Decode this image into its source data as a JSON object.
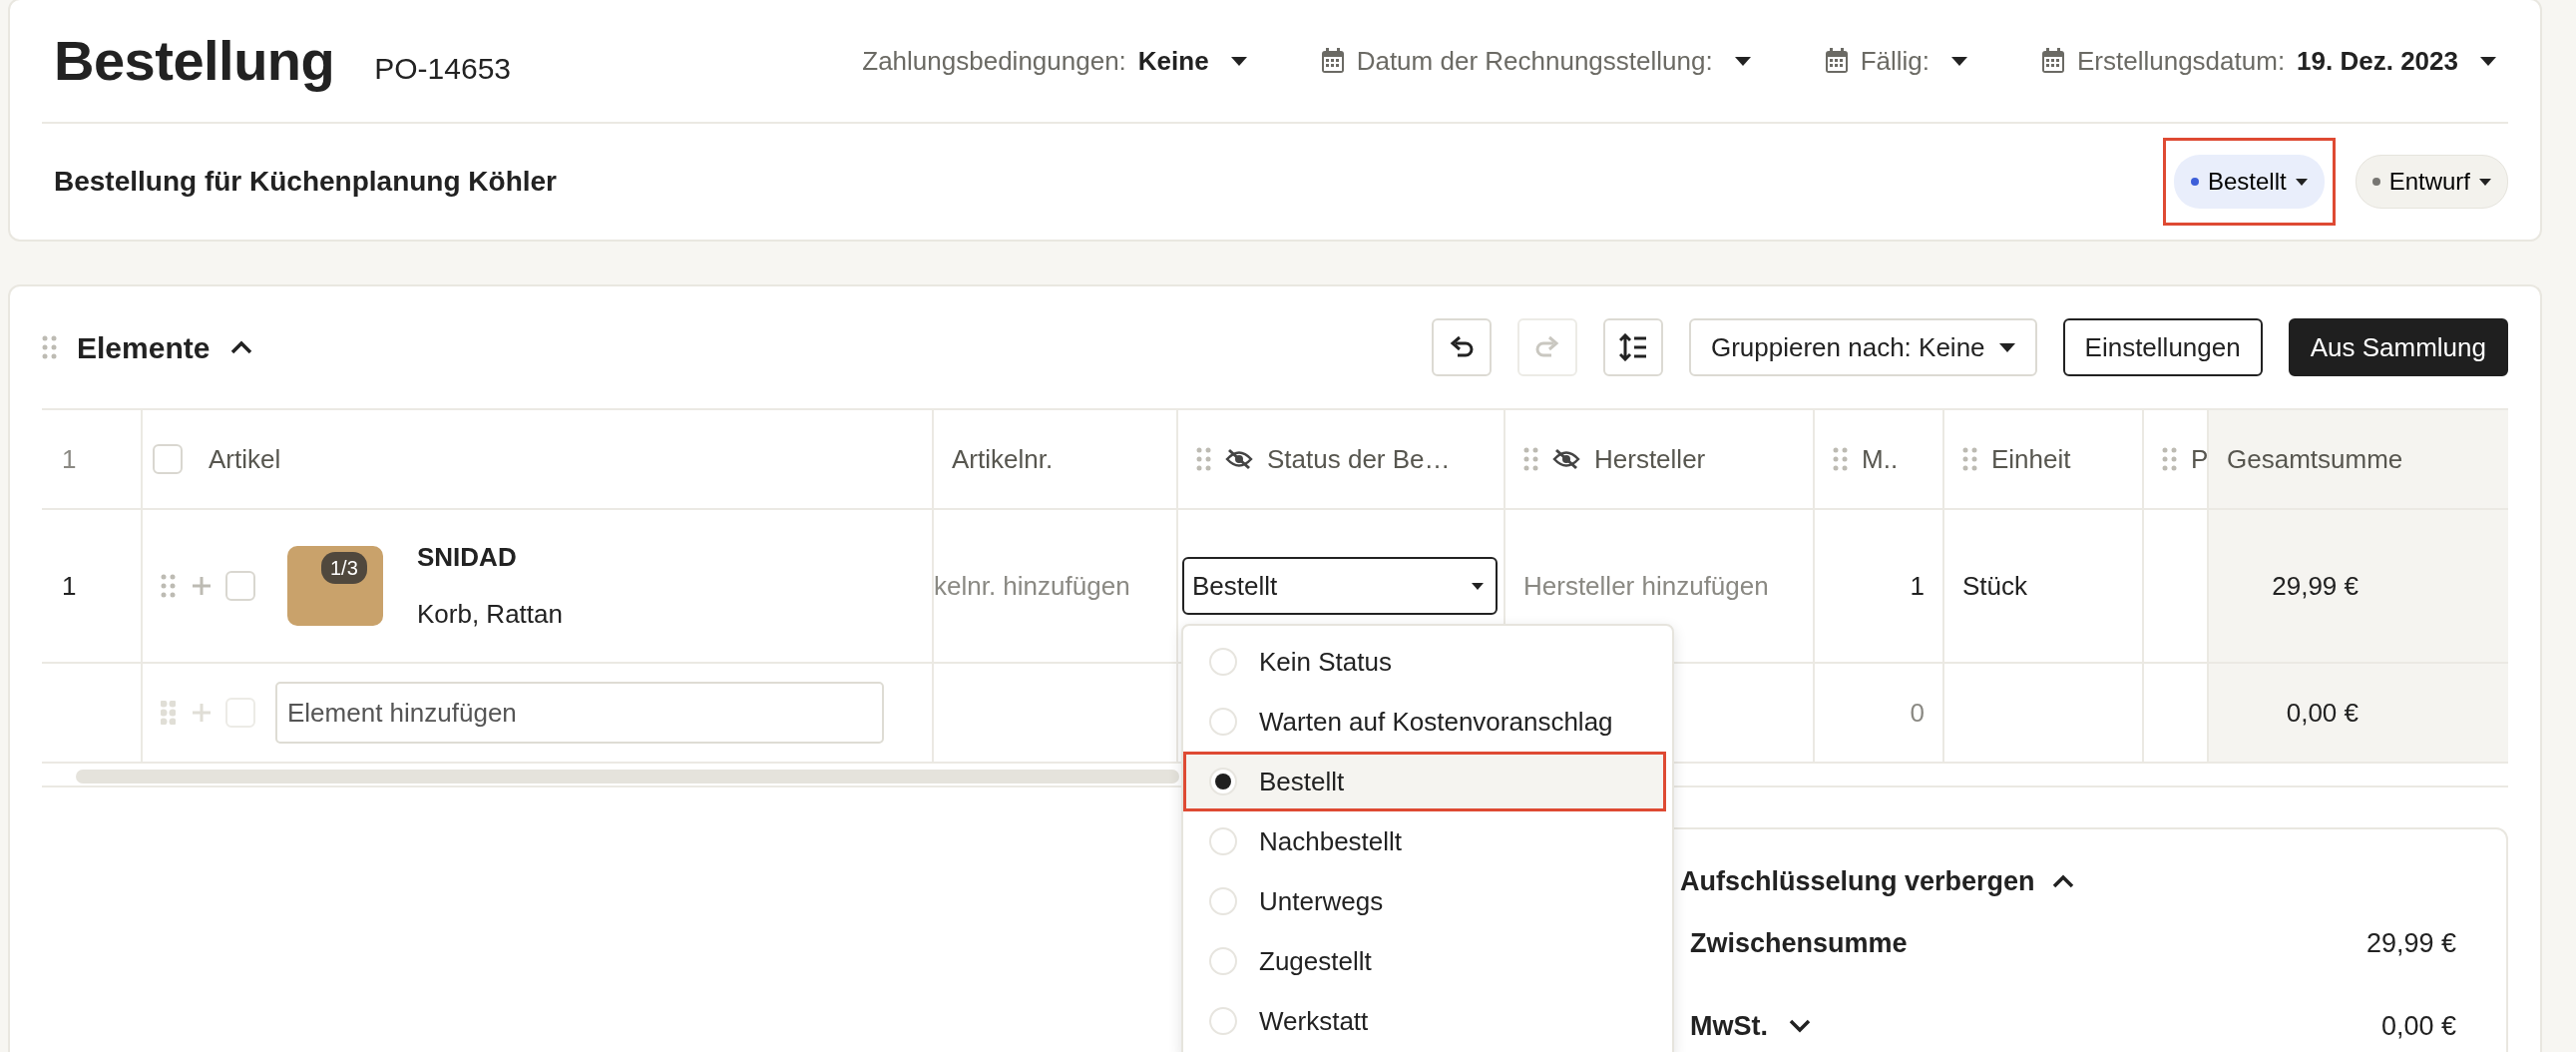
{
  "header": {
    "title": "Bestellung",
    "number": "PO-14653",
    "fields": [
      {
        "label": "Zahlungsbedingungen:",
        "value": "Keine",
        "icon": false
      },
      {
        "label": "Datum der Rechnungsstellung:",
        "icon": true
      },
      {
        "label": "Fällig:",
        "icon": true
      },
      {
        "label": "Erstellungsdatum:",
        "value": "19. Dez. 2023",
        "icon": true
      }
    ],
    "subtitle": "Bestellung für Küchenplanung Köhler",
    "pills": [
      {
        "label": "Bestellt",
        "color": "#3d5fd9",
        "highlighted": true
      },
      {
        "label": "Entwurf",
        "color": "#777672",
        "highlighted": false
      }
    ]
  },
  "items": {
    "title": "Elemente",
    "expanded": true,
    "toolbar": {
      "icon_buttons": [
        {
          "kind": "undo",
          "disabled": false
        },
        {
          "kind": "redo",
          "disabled": true
        },
        {
          "kind": "row-height",
          "disabled": false
        }
      ],
      "group_by": "Gruppieren nach: Keine",
      "buttons": [
        {
          "label": "Einstellungen",
          "kind": "outline"
        },
        {
          "label": "Aus Sammlung",
          "kind": "dark"
        }
      ]
    },
    "table": {
      "header_number": "1",
      "columns": [
        {
          "label": "Artikel",
          "kind": "item",
          "checked": false
        },
        {
          "label": "Artikelnr.",
          "kind": "plain"
        },
        {
          "label": "Status der Be…",
          "kind": "hidden"
        },
        {
          "label": "Hersteller",
          "kind": "hidden"
        },
        {
          "label": "M..",
          "kind": "drag"
        },
        {
          "label": "Einheit",
          "kind": "drag"
        },
        {
          "label": "P",
          "kind": "drag"
        },
        {
          "label": "Gesamtsumme",
          "kind": "total"
        }
      ],
      "rows": [
        {
          "number": "1",
          "checked": false,
          "name": "SNIDAD",
          "description": "Korb, Rattan",
          "image_count": "1/3",
          "article_no": {
            "placeholder": "kelnr. hinzufügen"
          },
          "status": "Bestellt",
          "manufacturer": {
            "placeholder": "Hersteller hinzufügen"
          },
          "quantity": "1",
          "unit": "Stück",
          "total": "29,99 €"
        }
      ],
      "new_row": {
        "checked": false,
        "placeholder": "Element hinzufügen",
        "quantity": "0",
        "total": "0,00 €"
      }
    },
    "status_menu": {
      "options": [
        {
          "label": "Kein Status",
          "selected": false,
          "highlighted": false
        },
        {
          "label": "Warten auf Kostenvoranschlag",
          "selected": false,
          "highlighted": false
        },
        {
          "label": "Bestellt",
          "selected": true,
          "highlighted": true
        },
        {
          "label": "Nachbestellt",
          "selected": false,
          "highlighted": false
        },
        {
          "label": "Unterwegs",
          "selected": false,
          "highlighted": false
        },
        {
          "label": "Zugestellt",
          "selected": false,
          "highlighted": false
        },
        {
          "label": "Werkstatt",
          "selected": false,
          "highlighted": false
        }
      ]
    }
  },
  "summary": {
    "toggle": "Aufschlüsselung verbergen",
    "expanded": true,
    "lines": [
      {
        "label": "Zwischensumme",
        "value": "29,99 €",
        "kind": "plain"
      },
      {
        "label": "MwSt.",
        "value": "0,00 €",
        "kind": "expandable"
      }
    ]
  }
}
